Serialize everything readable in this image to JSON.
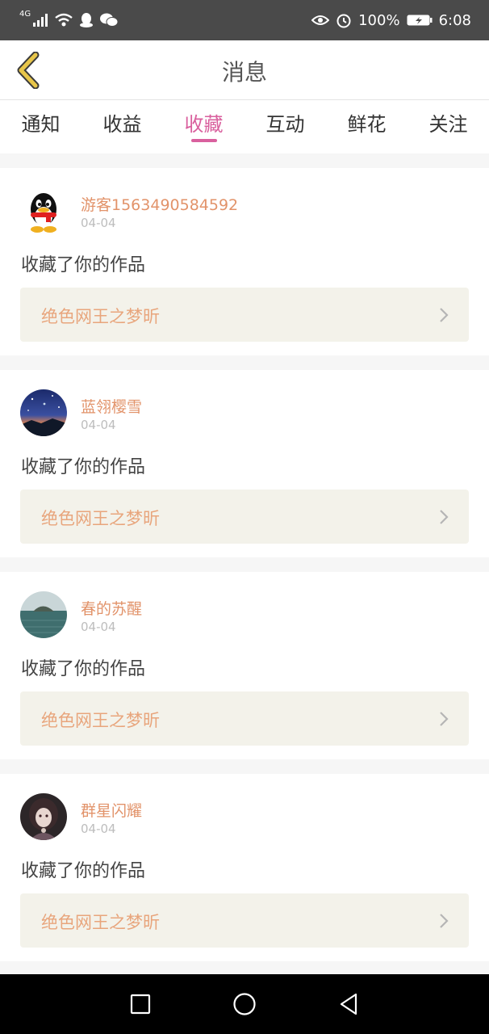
{
  "status_bar": {
    "network": "4G",
    "battery": "100%",
    "time": "6:08",
    "icons": [
      "signal-icon",
      "wifi-icon",
      "qq-icon",
      "wechat-icon",
      "eye-icon",
      "alarm-icon",
      "battery-icon"
    ]
  },
  "header": {
    "title": "消息",
    "back_icon": "chevron-left-icon",
    "accent_color": "#e8c64a"
  },
  "tabs": [
    {
      "label": "通知",
      "active": false
    },
    {
      "label": "收益",
      "active": false
    },
    {
      "label": "收藏",
      "active": true
    },
    {
      "label": "互动",
      "active": false
    },
    {
      "label": "鲜花",
      "active": false
    },
    {
      "label": "关注",
      "active": false
    }
  ],
  "active_tab_color": "#d9609e",
  "messages": [
    {
      "username": "游客1563490584592",
      "date": "04-04",
      "action": "收藏了你的作品",
      "work_title": "绝色网王之梦昕",
      "avatar": "qq-penguin-avatar"
    },
    {
      "username": "蓝翎樱雪",
      "date": "04-04",
      "action": "收藏了你的作品",
      "work_title": "绝色网王之梦昕",
      "avatar": "starry-sky-avatar"
    },
    {
      "username": "春的苏醒",
      "date": "04-04",
      "action": "收藏了你的作品",
      "work_title": "绝色网王之梦昕",
      "avatar": "sea-island-avatar"
    },
    {
      "username": "群星闪耀",
      "date": "04-04",
      "action": "收藏了你的作品",
      "work_title": "绝色网王之梦昕",
      "avatar": "anime-girl-avatar"
    }
  ],
  "colors": {
    "username": "#e2936a",
    "work_title": "#e8a57c",
    "work_bg": "#f3f2ea"
  },
  "nav_bar": {
    "icons": [
      "recent-apps-icon",
      "home-icon",
      "back-icon"
    ]
  }
}
